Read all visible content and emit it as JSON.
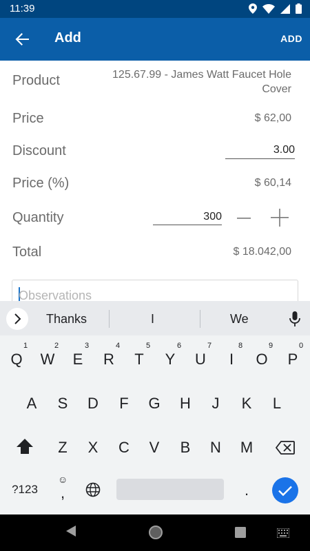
{
  "status_bar": {
    "time": "11:39"
  },
  "app_bar": {
    "title": "Add",
    "action": "ADD"
  },
  "form": {
    "product_label": "Product",
    "product_value_line1": "125.67.99 - James Watt Faucet Hole",
    "product_value_line2": "Cover",
    "price_label": "Price",
    "price_value": "$ 62,00",
    "discount_label": "Discount",
    "discount_value": "3.00",
    "price_pct_label": "Price (%)",
    "price_pct_value": "$ 60,14",
    "quantity_label": "Quantity",
    "quantity_value": "300",
    "total_label": "Total",
    "total_value": "$ 18.042,00",
    "observations_placeholder": "Observations"
  },
  "keyboard": {
    "suggestions": [
      "Thanks",
      "I",
      "We"
    ],
    "row1": [
      "Q",
      "W",
      "E",
      "R",
      "T",
      "Y",
      "U",
      "I",
      "O",
      "P"
    ],
    "row1_hints": [
      "1",
      "2",
      "3",
      "4",
      "5",
      "6",
      "7",
      "8",
      "9",
      "0"
    ],
    "row2": [
      "A",
      "S",
      "D",
      "F",
      "G",
      "H",
      "J",
      "K",
      "L"
    ],
    "row3": [
      "Z",
      "X",
      "C",
      "V",
      "B",
      "N",
      "M"
    ],
    "symbols_key": "?123",
    "comma_key": ",",
    "period_key": ".",
    "accent_color": "#1a73e8"
  },
  "colors": {
    "app_bar": "#0b5ea8",
    "status_bar": "#00457f"
  }
}
